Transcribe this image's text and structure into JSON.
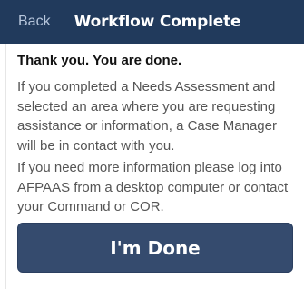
{
  "header": {
    "back_label": "Back",
    "title": "Workflow Complete"
  },
  "content": {
    "heading": "Thank you. You are done.",
    "paragraph1": "If you completed a Needs Assessment and selected an area where you are requesting assistance or information, a Case Manager will be in contact with you.",
    "paragraph2": "If you need more information please log into AFPAAS from a desktop computer or contact your Command or COR."
  },
  "actions": {
    "done_label": "I'm Done"
  },
  "colors": {
    "header_bg": "#213a5c",
    "button_bg": "#354b6e",
    "back_text": "#b7c6dc",
    "body_text": "#555555"
  }
}
